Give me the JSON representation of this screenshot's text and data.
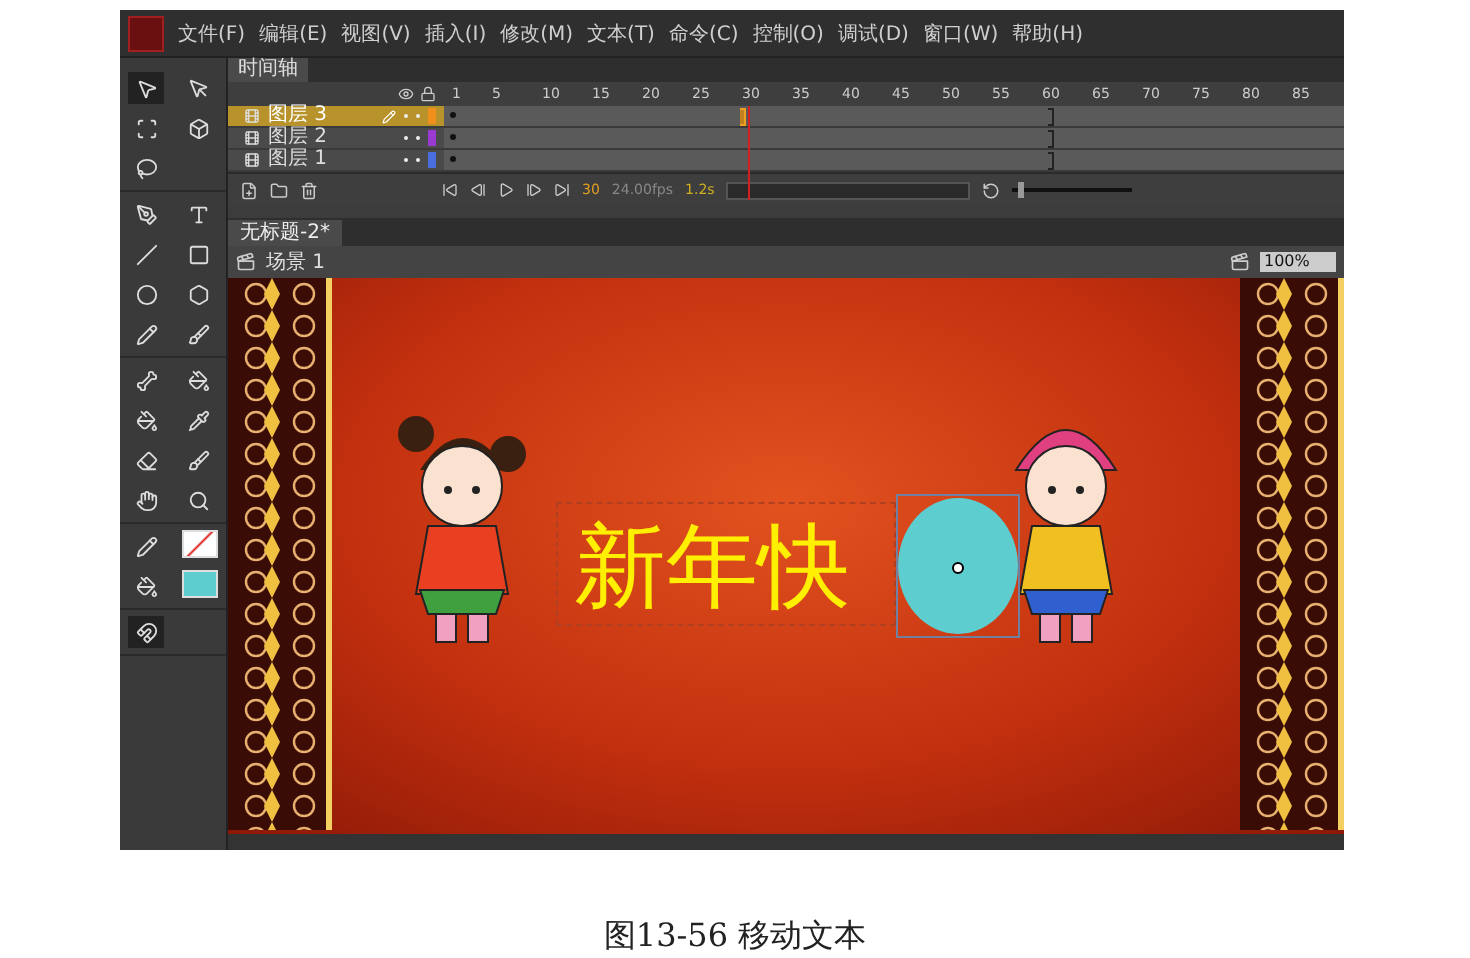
{
  "menu": {
    "items": [
      "文件(F)",
      "编辑(E)",
      "视图(V)",
      "插入(I)",
      "修改(M)",
      "文本(T)",
      "命令(C)",
      "控制(O)",
      "调试(D)",
      "窗口(W)",
      "帮助(H)"
    ]
  },
  "timeline": {
    "tab": "时间轴",
    "ruler": [
      "1",
      "5",
      "10",
      "15",
      "20",
      "25",
      "30",
      "35",
      "40",
      "45",
      "50",
      "55",
      "60",
      "65",
      "70",
      "75",
      "80",
      "85"
    ],
    "layers": [
      {
        "name": "图层 3",
        "selected": true,
        "color": "#f0901a"
      },
      {
        "name": "图层 2",
        "selected": false,
        "color": "#9a3ad0"
      },
      {
        "name": "图层 1",
        "selected": false,
        "color": "#4a6ee0"
      }
    ],
    "current_frame": "30",
    "frame_rate": "24.00fps",
    "elapsed": "1.2s",
    "zoom_slider": {
      "level": 0.04
    }
  },
  "document": {
    "tab": "无标题-2*",
    "scene": "场景 1",
    "zoom": "100%"
  },
  "stage": {
    "text": "新年快"
  },
  "caption": "图13-56 移动文本"
}
